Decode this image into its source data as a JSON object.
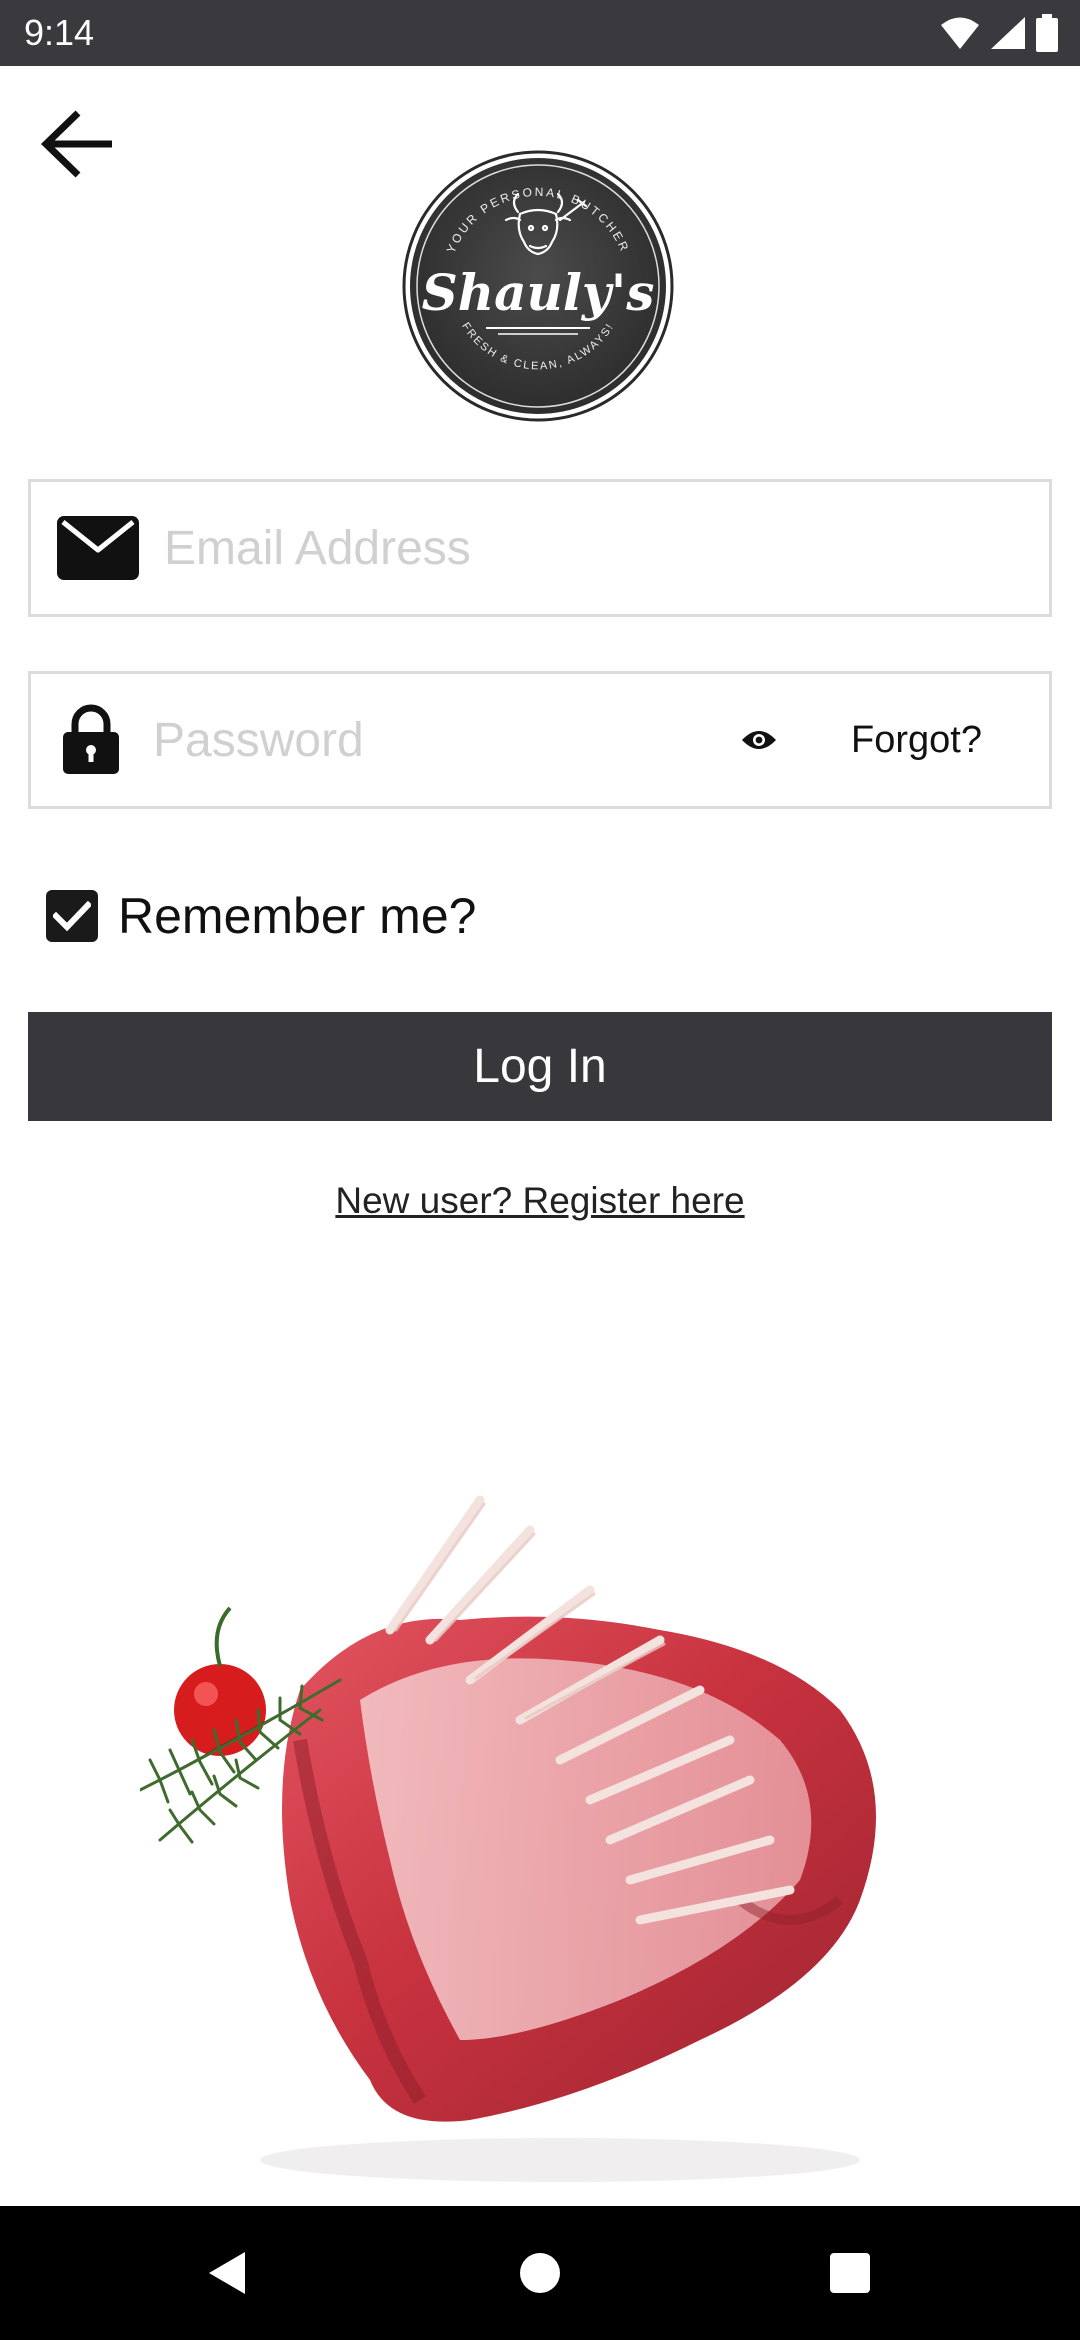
{
  "status_bar": {
    "time": "9:14",
    "icons": [
      "wifi-icon",
      "signal-icon",
      "battery-icon"
    ]
  },
  "header": {
    "back_icon": "arrow-left-icon"
  },
  "logo": {
    "top_text": "YOUR PERSONAL BUTCHER",
    "brand": "Shauly's",
    "bottom_text": "FRESH & CLEAN, ALWAYS!"
  },
  "form": {
    "email": {
      "placeholder": "Email Address",
      "value": "",
      "icon": "envelope-icon"
    },
    "password": {
      "placeholder": "Password",
      "value": "",
      "icon": "lock-icon",
      "toggle_icon": "eye-icon",
      "forgot_label": "Forgot?"
    },
    "remember": {
      "label": "Remember me?",
      "checked": true
    },
    "login_label": "Log In",
    "register_label": "New user? Register here"
  },
  "hero_image": "rack-of-lamb-photo",
  "colors": {
    "status_bar": "#3a393e",
    "button": "#38373c",
    "field_border": "#dcdcdc",
    "placeholder": "#d0d0d0"
  },
  "nav_bar": {
    "buttons": [
      "back-triangle-icon",
      "home-circle-icon",
      "recents-square-icon"
    ]
  }
}
